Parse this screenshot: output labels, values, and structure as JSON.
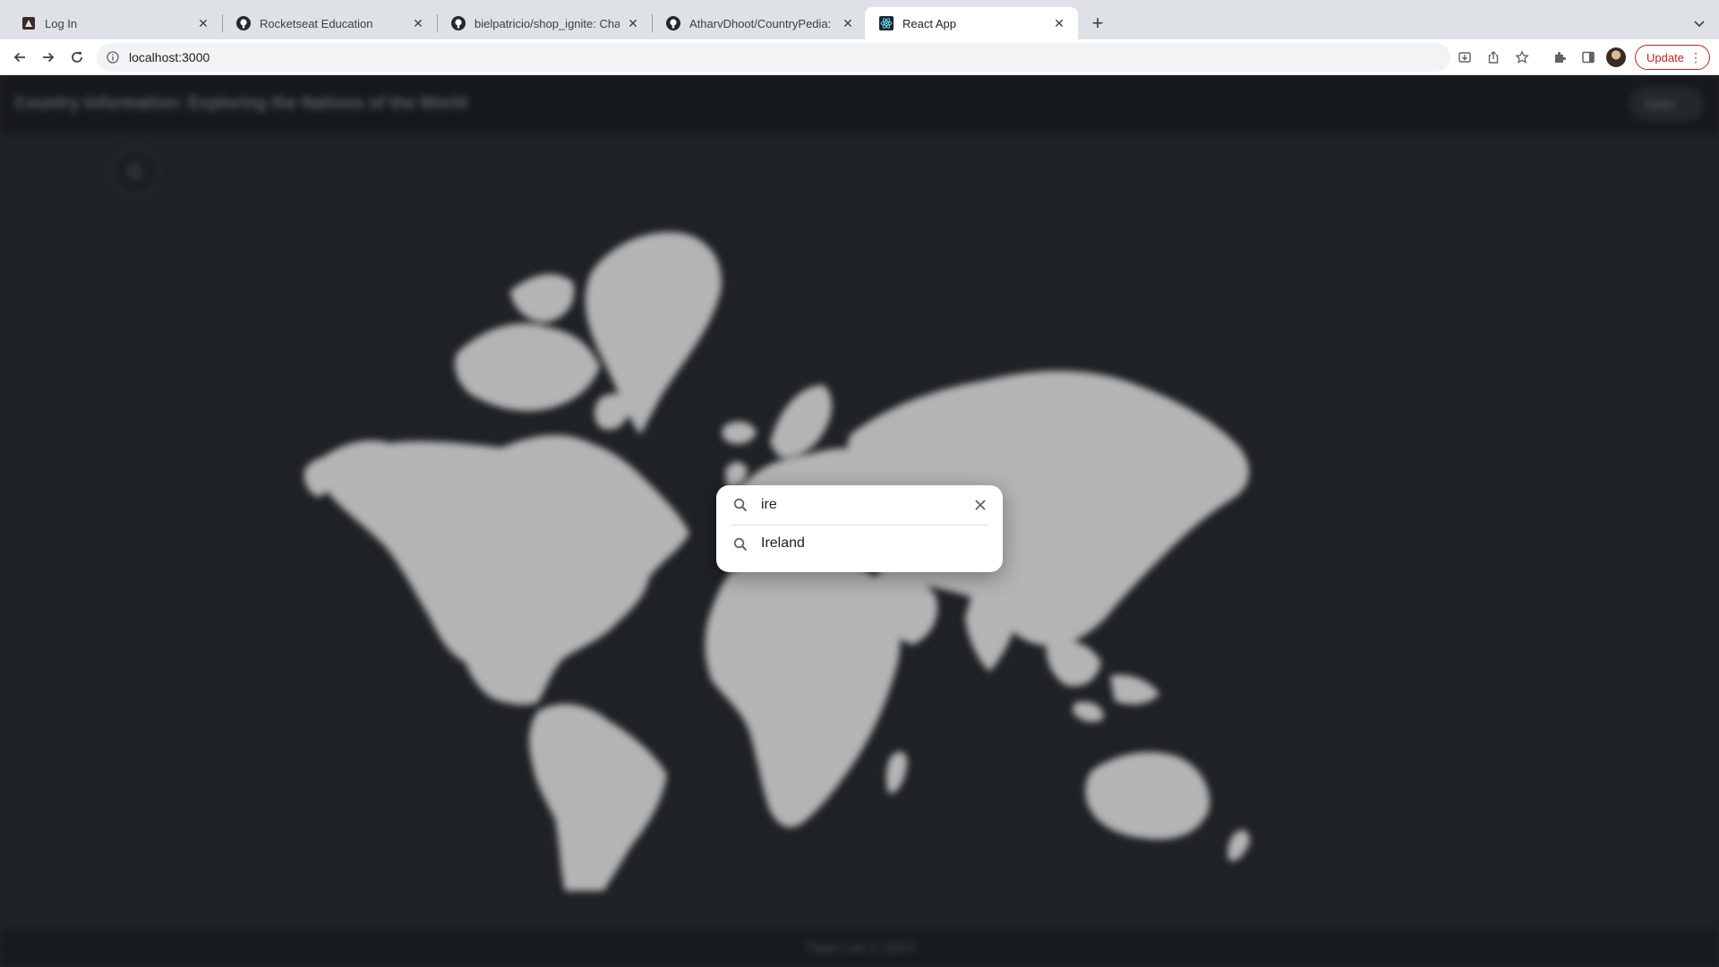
{
  "browser": {
    "tabs": [
      {
        "title": "Log In",
        "icon": "app-favicon-icon",
        "active": false
      },
      {
        "title": "Rocketseat Education",
        "icon": "github-icon",
        "active": false
      },
      {
        "title": "bielpatricio/shop_ignite: Challe",
        "icon": "github-icon",
        "active": false
      },
      {
        "title": "AtharvDhoot/CountryPedia: Ex",
        "icon": "github-icon",
        "active": false
      },
      {
        "title": "React App",
        "icon": "react-icon",
        "active": true
      }
    ],
    "url": "localhost:3000",
    "update_label": "Update"
  },
  "app": {
    "title": "Country Information: Exploring the Nations of the World",
    "theme_button": "Dark",
    "footer": "Tiago Luiz © 2023"
  },
  "search": {
    "query": "ire",
    "results": [
      {
        "label": "Ireland",
        "icon": "search-icon"
      }
    ]
  },
  "colors": {
    "page_background": "#1f2226",
    "map_land": "#b4b4b4",
    "update_accent": "#c5221f"
  }
}
